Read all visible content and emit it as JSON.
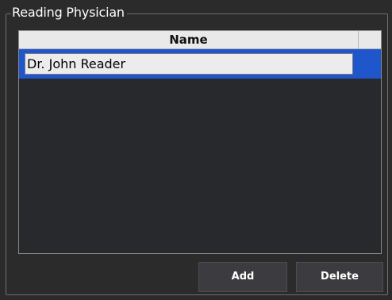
{
  "group": {
    "title": "Reading Physician"
  },
  "grid": {
    "columns": [
      "Name"
    ],
    "rows": [
      {
        "name": "Dr. John Reader",
        "selected": true
      }
    ]
  },
  "buttons": {
    "add_label": "Add",
    "delete_label": "Delete"
  },
  "colors": {
    "background": "#2b2b2b",
    "selection": "#1f56cc",
    "header": "#e9e9e9"
  }
}
